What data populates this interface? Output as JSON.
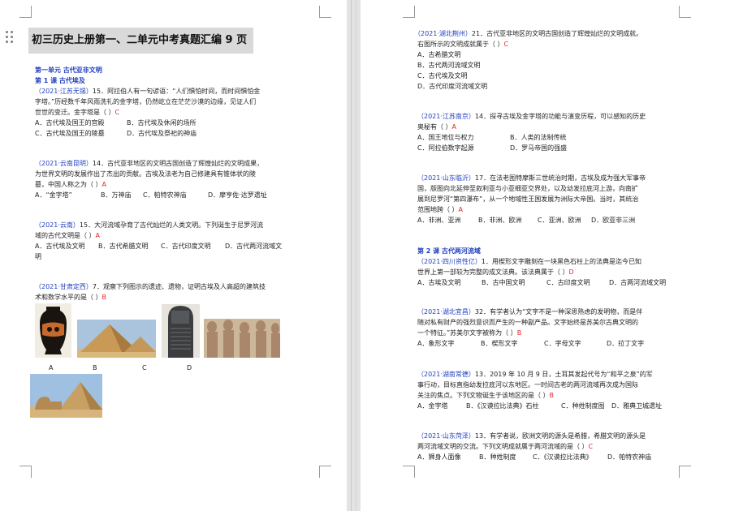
{
  "title": "初三历史上册第一、二单元中考真题汇编 9 页",
  "unit1": "第一单元  古代亚非文明",
  "lesson1": "第 1 课   古代埃及",
  "lesson2": "第 2 课  古代两河流域",
  "left_questions": [
    {
      "source": "（2021·江苏无锡）",
      "lines": [
        "15．阿拉伯人有一句谚语：“人们惧怕时间，而时间惧怕金",
        "字塔。”历经数千年风雨洗礼的金字塔，仍然屹立在茫茫沙漠的边缘，见证人们",
        "世世的变迁。金字塔是（   ）"
      ],
      "answer": "C",
      "options": [
        [
          "A．古代埃及国王的宫殿",
          "B．古代埃及休闲的场所"
        ],
        [
          "C．古代埃及国王的陵墓",
          "D．古代埃及祭祀的神庙"
        ]
      ]
    },
    {
      "source": "（2021·云南昆明）",
      "lines": [
        "14．古代亚非地区的文明古国创造了辉煌灿烂的文明成果，",
        "为世界文明的发展作出了杰出的贡献。古埃及法老为自己修建具有锥体状的陵",
        "墓，中国人称之为（   ）"
      ],
      "answer": "A",
      "options": [
        [
          "A．“金字塔”",
          "B．万神庙",
          "C．帕特农神庙",
          "D．摩亨佐·达罗遗址"
        ]
      ]
    },
    {
      "source": "（2021·云南）",
      "lines": [
        "15．大河流域孕育了古代灿烂的人类文明。下列诞生于尼罗河流",
        "域的古代文明是（   ）"
      ],
      "answer": "A",
      "options": [
        [
          "A．古代埃及文明",
          "B．古代希腊文明",
          "C．古代印度文明",
          "D．古代两河流域文"
        ],
        [
          "明"
        ]
      ]
    },
    {
      "source": "（2021·甘肃定西）",
      "lines": [
        "7．观察下列图示的遗迹、遗物，证明古埃及人高超的建筑技",
        "术和数学水平的是（   ）"
      ],
      "answer": "B",
      "images": [
        "A",
        "B",
        "C",
        "D"
      ]
    }
  ],
  "right_questions": [
    {
      "source": "（2021·湖北荆州）",
      "lines": [
        "21．古代亚非地区的文明古国创造了辉煌灿烂的文明成就。",
        "右图所示的文明成就属于（   ）"
      ],
      "answer": "C",
      "options": [
        [
          "A．古希腊文明"
        ],
        [
          "B．古代两河流域文明"
        ],
        [
          "C．古代埃及文明"
        ],
        [
          "D．古代印度河流域文明"
        ]
      ]
    },
    {
      "source": "（2021·江苏南京）",
      "lines": [
        "14．探寻古埃及金字塔的功能与演变历程，可以感知的历史",
        "奥秘有（   ）"
      ],
      "answer": "A",
      "options": [
        [
          "A．国王地位与权力",
          "B．人类的法制传统"
        ],
        [
          "C．阿拉伯数字起源",
          "D．罗马帝国的强盛"
        ]
      ]
    },
    {
      "source": "（2021·山东临沂）",
      "lines": [
        "17．在法老图特摩斯三世统治时期，古埃及成为强大军事帝",
        "国，版图向北延伸至叙利亚与小亚细亚交界处，以及幼发拉底河上游，向南扩",
        "展到尼罗河“第四瀑布”，从一个地域性王国发展为洲际大帝国。当时，其统治",
        "范围地跨（   ）"
      ],
      "answer": "A",
      "options": [
        [
          "A．非洲、亚洲",
          "B．非洲、欧洲",
          "C．亚洲、欧洲",
          "D．欧亚非三洲"
        ]
      ]
    },
    {
      "source": "（2021·四川资性亿）",
      "lines": [
        "1．用楔形文字雕刻在一块黑色石柱上的法典是迄今已知",
        "世界上第一部较为完整的成文法典。该法典属于（   ）"
      ],
      "answer": "D",
      "options": [
        [
          "A．古埃及文明",
          "B．古中国文明",
          "C．古印度文明",
          "D．古两河流域文明"
        ]
      ]
    },
    {
      "source": "（2021·湖北宜昌）",
      "lines": [
        "32．有学者认为“文字不是一种深思熟虑的发明物，而是伴",
        "随对私有财产的强烈意识而产生的一种副产品。文字始终是苏美尔古典文明的",
        "一个特征。”苏美尔文字被称为（   ）"
      ],
      "answer": "B",
      "options": [
        [
          "A．象形文字",
          "B．楔形文字",
          "C．字母文字",
          "D．拉丁文字"
        ]
      ]
    },
    {
      "source": "（2021·湖南常德）",
      "lines": [
        "13．2019 年 10 月 9 日，土耳其发起代号为“和平之泉”的军",
        "事行动，目标直指幼发拉底河以东地区。一时间古老的两河流域再次成为国际",
        "关注的焦点。下列文物诞生于该地区的是（   ）"
      ],
      "answer": "B",
      "options": [
        [
          "A．金字塔",
          "B．《汉谟拉比法典》石柱",
          "C．种姓制度图",
          "D．雅典卫城遗址"
        ]
      ]
    },
    {
      "source": "（2021·山东菏泽）",
      "lines": [
        "13．有学者说，欧洲文明的源头是希腊，希腊文明的源头是",
        "两河流域文明的交流。下列文明成就属于两河流域的是（   ）"
      ],
      "answer": "C",
      "options": [
        [
          "A．狮身人面像",
          "B．种姓制度",
          "C．《汉谟拉比法典》",
          "D．帕特农神庙"
        ]
      ]
    }
  ]
}
